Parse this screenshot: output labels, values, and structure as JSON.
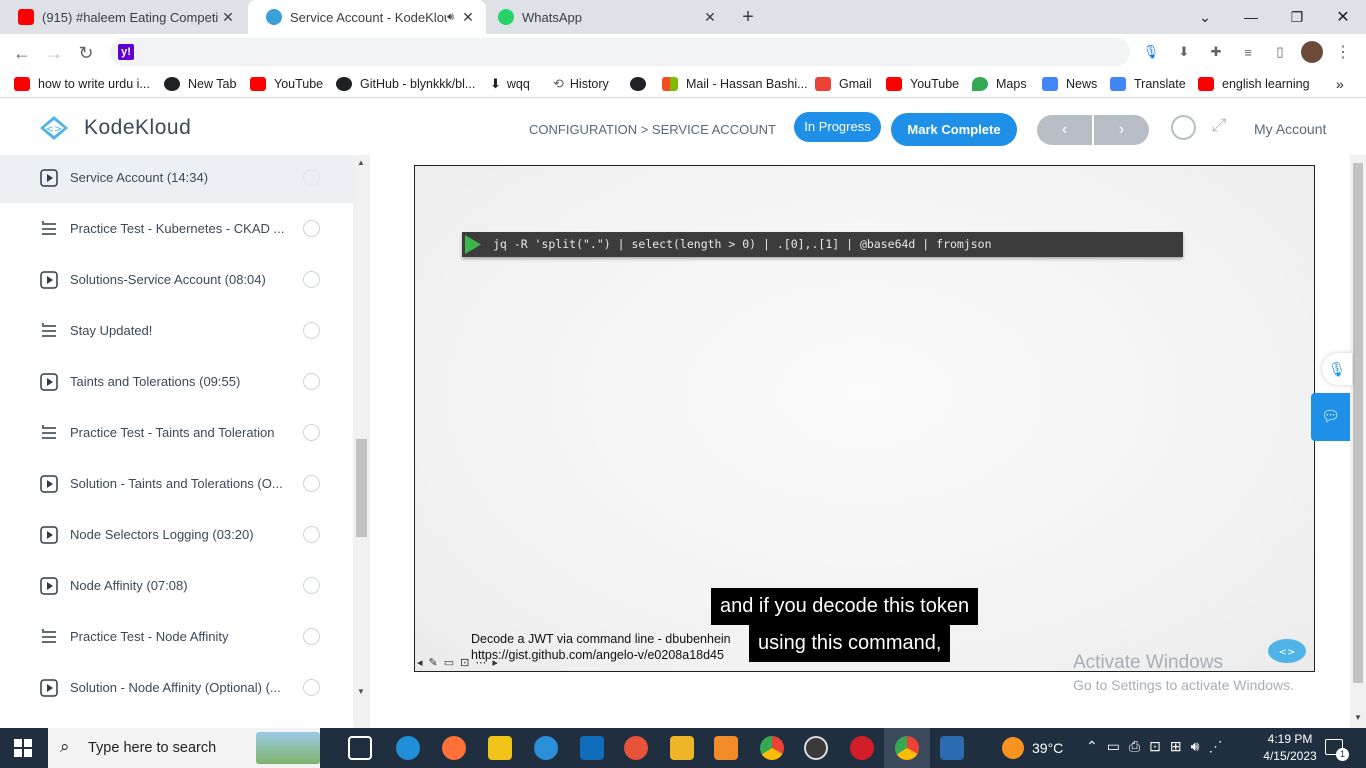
{
  "browser": {
    "tabs": [
      {
        "title": "(915) #haleem Eating Competitio",
        "favicon_color": "#ff0000",
        "active": false
      },
      {
        "title": "Service Account - KodeKloud",
        "favicon_color": "#3aa0d8",
        "active": true
      },
      {
        "title": "WhatsApp",
        "favicon_color": "#25d366",
        "active": false
      }
    ],
    "bookmarks": [
      {
        "label": "how to write urdu i...",
        "color": "#ff0000"
      },
      {
        "label": "New Tab",
        "color": "#202124"
      },
      {
        "label": "YouTube",
        "color": "#ff0000"
      },
      {
        "label": "GitHub - blynkkk/bl...",
        "color": "#202124"
      },
      {
        "label": "wqq",
        "color": "#202124"
      },
      {
        "label": "History",
        "color": "#5f6368"
      },
      {
        "label": "",
        "color": "#202124"
      },
      {
        "label": "Mail - Hassan Bashi...",
        "color": "#f25022"
      },
      {
        "label": "Gmail",
        "color": "#ea4335"
      },
      {
        "label": "YouTube",
        "color": "#ff0000"
      },
      {
        "label": "Maps",
        "color": "#34a853"
      },
      {
        "label": "News",
        "color": "#4285f4"
      },
      {
        "label": "Translate",
        "color": "#4285f4"
      },
      {
        "label": "english learning",
        "color": "#ff0000"
      }
    ]
  },
  "site": {
    "logo_text": "KodeKloud",
    "breadcrumb": "CONFIGURATION > SERVICE ACCOUNT",
    "in_progress_label": "In Progress",
    "mark_complete_label": "Mark Complete",
    "my_account_label": "My Account",
    "accent": "#1e90e8"
  },
  "sidebar": {
    "lessons": [
      {
        "label": "Service Account (14:34)",
        "icon": "play-icon",
        "selected": true
      },
      {
        "label": "Practice Test - Kubernetes - CKAD ...",
        "icon": "list-icon",
        "selected": false
      },
      {
        "label": "Solutions-Service Account (08:04)",
        "icon": "play-icon",
        "selected": false
      },
      {
        "label": "Stay Updated!",
        "icon": "list-icon",
        "selected": false
      },
      {
        "label": "Taints and Tolerations (09:55)",
        "icon": "play-icon",
        "selected": false
      },
      {
        "label": "Practice Test - Taints and Toleration",
        "icon": "list-icon",
        "selected": false
      },
      {
        "label": "Solution - Taints and Tolerations (O...",
        "icon": "play-icon",
        "selected": false
      },
      {
        "label": "Node Selectors Logging (03:20)",
        "icon": "play-icon",
        "selected": false
      },
      {
        "label": "Node Affinity (07:08)",
        "icon": "play-icon",
        "selected": false
      },
      {
        "label": "Practice Test - Node Affinity",
        "icon": "list-icon",
        "selected": false
      },
      {
        "label": "Solution - Node Affinity (Optional) (...",
        "icon": "play-icon",
        "selected": false
      }
    ]
  },
  "video": {
    "command": "jq -R 'split(\".\") | select(length > 0) | .[0],.[1] | @base64d | fromjson",
    "reference_line1": "Decode a JWT via command line - dbubenhein",
    "reference_line2": "https://gist.github.com/angelo-v/e0208a18d45",
    "caption_line1": "and if you decode this token",
    "caption_line2": "using this command,"
  },
  "watermark": {
    "title": "Activate Windows",
    "subtitle": "Go to Settings to activate Windows."
  },
  "taskbar": {
    "search_placeholder": "Type here to search",
    "weather": "39°C",
    "time": "4:19 PM",
    "date": "4/15/2023",
    "notification_count": "1"
  }
}
